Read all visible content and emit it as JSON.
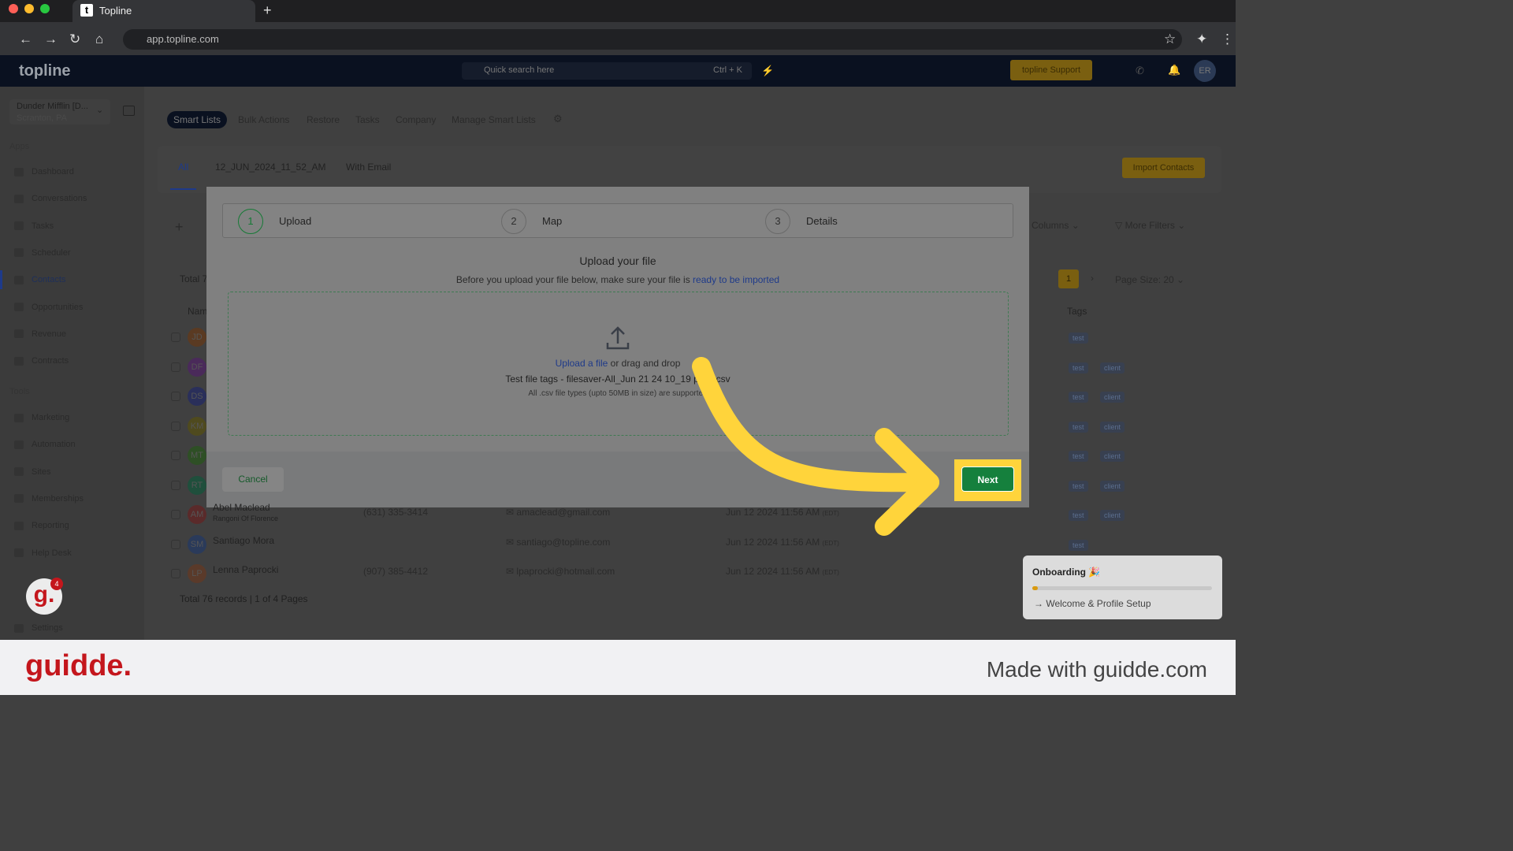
{
  "browser": {
    "tab_title": "Topline",
    "url": "app.topline.com"
  },
  "header": {
    "logo": "topline",
    "search_placeholder": "Quick search here",
    "search_shortcut": "Ctrl + K",
    "support_label": "topline Support",
    "avatar": "ER"
  },
  "account": {
    "name": "Dunder Mifflin [D...",
    "location": "Scranton, PA"
  },
  "sidebar": {
    "apps_label": "Apps",
    "tools_label": "Tools",
    "apps": [
      "Dashboard",
      "Conversations",
      "Tasks",
      "Scheduler",
      "Contacts",
      "Opportunities",
      "Revenue",
      "Contracts"
    ],
    "tools": [
      "Marketing",
      "Automation",
      "Sites",
      "Memberships",
      "Reporting",
      "Help Desk"
    ],
    "settings": "Settings",
    "notification_count": "4"
  },
  "top_tabs": [
    "Smart Lists",
    "Bulk Actions",
    "Restore",
    "Tasks",
    "Company",
    "Manage Smart Lists"
  ],
  "list_tabs": [
    "All",
    "12_JUN_2024_11_52_AM",
    "With Email"
  ],
  "toolbar": {
    "import": "Import Contacts",
    "columns": "Columns",
    "more_filters": "More Filters",
    "total": "Total 7",
    "page": "1",
    "page_size": "Page Size: 20"
  },
  "table": {
    "name_header": "Nam",
    "tags_header": "Tags",
    "rows": [
      {
        "initials": "JD",
        "color": "#5a3a22",
        "tags": [
          "test"
        ]
      },
      {
        "initials": "DF",
        "color": "#4a2a5a",
        "tags": [
          "test",
          "client"
        ]
      },
      {
        "initials": "DS",
        "color": "#2a2f5a",
        "tags": [
          "test",
          "client"
        ]
      },
      {
        "initials": "KM",
        "color": "#4f4a1e",
        "tags": [
          "test",
          "client"
        ]
      },
      {
        "initials": "MT",
        "color": "#2e4f25",
        "tags": [
          "test",
          "client"
        ]
      },
      {
        "initials": "RT",
        "color": "#1f4f3c",
        "tags": [
          "test",
          "client"
        ]
      },
      {
        "initials": "AM",
        "color": "#5a2a2a",
        "name": "Abel Maclead",
        "company": "Rangoni Of Florence",
        "phone": "(631) 335-3414",
        "email": "amaclead@gmail.com",
        "date": "Jun 12 2024 11:56 AM",
        "tz": "(EDT)",
        "tags": [
          "test",
          "client"
        ]
      },
      {
        "initials": "SM",
        "color": "#2a3a5a",
        "name": "Santiago Mora",
        "company": "",
        "phone": "",
        "email": "santiago@topline.com",
        "date": "Jun 12 2024 11:56 AM",
        "tz": "(EDT)",
        "tags": [
          "test"
        ]
      },
      {
        "initials": "LP",
        "color": "#5a3a2a",
        "name": "Lenna Paprocki",
        "company": "",
        "phone": "(907) 385-4412",
        "email": "lpaprocki@hotmail.com",
        "date": "Jun 12 2024 11:56 AM",
        "tz": "(EDT)",
        "tags": []
      }
    ],
    "footer": "Total 76 records | 1 of 4 Pages"
  },
  "modal": {
    "steps": [
      {
        "num": "1",
        "label": "Upload"
      },
      {
        "num": "2",
        "label": "Map"
      },
      {
        "num": "3",
        "label": "Details"
      }
    ],
    "title": "Upload your file",
    "subtitle": "Before you upload your file below, make sure your file is ",
    "subtitle_link": "ready to be imported",
    "upload_link": "Upload a file",
    "upload_rest": " or drag and drop",
    "file_name": "Test file tags - filesaver-All_Jun 21 24 10_19 pr...v.csv",
    "hint": "All .csv file types (upto 50MB in size) are supported",
    "cancel": "Cancel",
    "next": "Next"
  },
  "onboarding": {
    "title": "Onboarding 🎉",
    "progress": 0.03,
    "item": "Welcome & Profile Setup"
  },
  "guidde": {
    "logo": "guidde.",
    "tagline": "Made with guidde.com"
  },
  "colors": {
    "accent": "#15803d",
    "highlight": "#ffd43b",
    "brand_red": "#c4161c"
  }
}
